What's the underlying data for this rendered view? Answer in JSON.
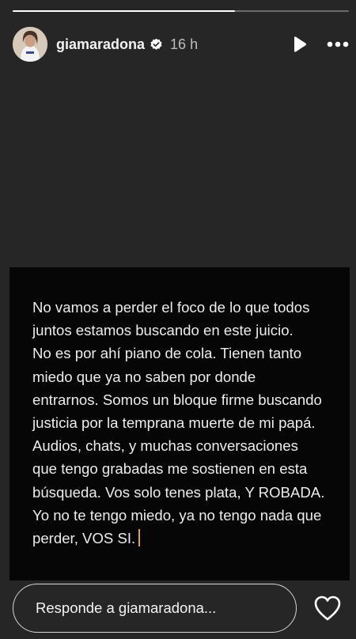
{
  "progress": {
    "fraction": 0.66
  },
  "header": {
    "username": "giamaradona",
    "verified": true,
    "time": "16 h",
    "avatar_icon": "avatar-photo",
    "play_icon": "play-icon",
    "more_icon": "more-icon"
  },
  "story": {
    "text": "No vamos a perder el foco de lo que todos\njuntos estamos buscando en este juicio.\nNo es por ahí piano de cola. Tienen tanto\nmiedo que ya no saben por donde\nentrarnos. Somos un bloque firme buscando\njusticia por la temprana muerte de mi papá.\nAudios, chats, y muchas conversaciones\nque tengo grabadas me sostienen en esta\nbúsqueda. Vos solo tenes plata, Y ROBADA.\nYo no te tengo miedo, ya no tengo nada que\nperder, VOS SI.",
    "caret_color": "#d9a84a"
  },
  "reply": {
    "placeholder": "Responde a giamaradona..."
  },
  "colors": {
    "background": "#262626",
    "card": "#060606"
  }
}
